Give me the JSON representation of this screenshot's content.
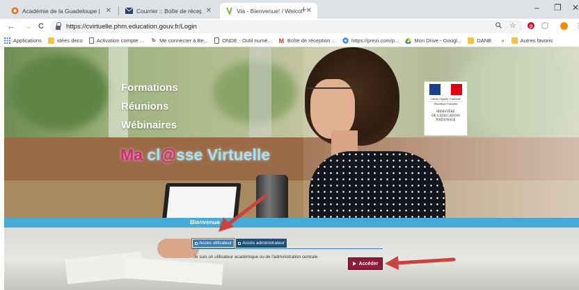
{
  "browser": {
    "tabs": [
      {
        "title": "Académie de la Guadeloupe | ac",
        "icon": "academie-favicon",
        "active": false
      },
      {
        "title": "Courrier :: Boîte de réception",
        "icon": "mail-favicon",
        "active": false
      },
      {
        "title": "Via - Bienvenue! / Welcome!",
        "icon": "via-favicon",
        "active": true
      }
    ],
    "new_tab": "+",
    "window_controls": {
      "minimize": "–",
      "maximize": "❐",
      "close": "✕"
    },
    "nav": {
      "back": "←",
      "forward": "→",
      "reload": "C"
    },
    "url": "https://cvirtuelle.phm.education.gouv.fr/Login",
    "bookmarks": [
      {
        "label": "Applications",
        "icon": "apps-grid-icon"
      },
      {
        "label": "idées deco",
        "icon": "folder-icon"
      },
      {
        "label": "Activation compte ...",
        "icon": "page-icon"
      },
      {
        "label": "Me connecter à Be...",
        "icon": "be-icon"
      },
      {
        "label": "ONDE - Outil numé...",
        "icon": "page-icon"
      },
      {
        "label": "Boîte de réception ...",
        "icon": "gmail-icon"
      },
      {
        "label": "https://prezi.com/p...",
        "icon": "prezi-icon"
      },
      {
        "label": "Mon Drive - Googl...",
        "icon": "drive-icon"
      },
      {
        "label": "DANE",
        "icon": "folder-icon"
      },
      {
        "label": "»",
        "icon": ""
      },
      {
        "label": "Autres favoris",
        "icon": "folder-icon"
      }
    ]
  },
  "hero": {
    "lines": [
      "Formations",
      "Réunions",
      "Wébinaires"
    ],
    "brand": {
      "ma": "Ma",
      "cl": " cl",
      "at": "@",
      "rest": "sse Virtuelle"
    }
  },
  "ministry_logo": {
    "motto": "Liberté • Égalité • Fraternité",
    "republic": "République Française",
    "name_line1": "MINISTÈRE",
    "name_line2": "DE L'ÉDUCATION",
    "name_line3": "NATIONALE"
  },
  "welcome": "Bienvenue",
  "access_tabs": [
    {
      "label": "Accès utilisateur",
      "selected": true
    },
    {
      "label": "Accès administrateur",
      "selected": false
    }
  ],
  "info_text": "Je suis un utilisateur académique ou de l'administration centrale.",
  "submit_label": "Accéder",
  "colors": {
    "accent_blue": "#46aad6",
    "tab_dark": "#1f4e78",
    "button": "#8b1d3b",
    "brand_pink": "#d2297f",
    "brand_cyan": "#9de6f7",
    "annotation_arrow": "#c9433f"
  }
}
